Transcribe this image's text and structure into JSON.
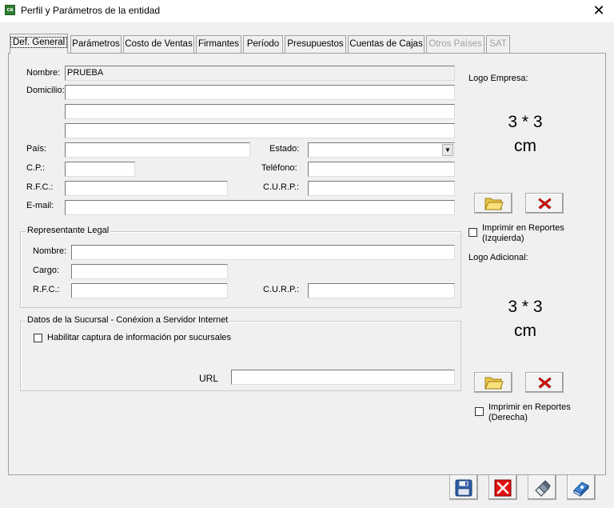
{
  "window": {
    "title": "Perfil y Parámetros de la entidad",
    "icon_text": "ca"
  },
  "tabs": [
    {
      "label": "Def. General",
      "active": true,
      "disabled": false
    },
    {
      "label": "Parámetros",
      "active": false,
      "disabled": false
    },
    {
      "label": "Costo de Ventas",
      "active": false,
      "disabled": false
    },
    {
      "label": "Firmantes",
      "active": false,
      "disabled": false
    },
    {
      "label": "Período",
      "active": false,
      "disabled": false
    },
    {
      "label": "Presupuestos",
      "active": false,
      "disabled": false
    },
    {
      "label": "Cuentas de Cajas",
      "active": false,
      "disabled": false
    },
    {
      "label": "Otros Países",
      "active": false,
      "disabled": true
    },
    {
      "label": "SAT",
      "active": false,
      "disabled": true
    }
  ],
  "general": {
    "nombre_label": "Nombre:",
    "nombre_value": "PRUEBA",
    "domicilio_label": "Domicilio:",
    "domicilio_1": "",
    "domicilio_2": "",
    "domicilio_3": "",
    "pais_label": "País:",
    "pais_value": "",
    "estado_label": "Estado:",
    "estado_value": "",
    "cp_label": "C.P.:",
    "cp_value": "",
    "telefono_label": "Teléfono:",
    "telefono_value": "",
    "rfc_label": "R.F.C.:",
    "rfc_value": "",
    "curp_label": "C.U.R.P.:",
    "curp_value": "",
    "email_label": "E-mail:",
    "email_value": ""
  },
  "representante": {
    "title": "Representante Legal",
    "nombre_label": "Nombre:",
    "nombre_value": "",
    "cargo_label": "Cargo:",
    "cargo_value": "",
    "rfc_label": "R.F.C.:",
    "rfc_value": "",
    "curp_label": "C.U.R.P.:",
    "curp_value": ""
  },
  "sucursal": {
    "title": "Datos de la Sucursal - Conéxion a Servidor Internet",
    "checkbox_label": "Habilitar captura de información por sucursales",
    "checked": false,
    "url_label": "URL",
    "url_value": ""
  },
  "logo_empresa": {
    "title": "Logo Empresa:",
    "size_line1": "3 * 3",
    "size_line2": "cm",
    "print_label_1": "Imprimir en Reportes",
    "print_label_2": "(Izquierda)",
    "checked": false
  },
  "logo_adicional": {
    "title": "Logo Adicional:",
    "size_line1": "3 * 3",
    "size_line2": "cm",
    "print_label_1": "Imprimir en Reportes",
    "print_label_2": "(Derecha)",
    "checked": false
  },
  "icons": {
    "folder": "folder-open-icon",
    "delete": "red-x-icon",
    "save": "floppy-disk-icon",
    "cancel": "cancel-icon",
    "eraser": "eraser-icon",
    "help": "help-book-icon"
  },
  "colors": {
    "accent_red": "#e01010",
    "folder_yellow": "#f5d96b",
    "save_blue": "#2f5fa8"
  }
}
